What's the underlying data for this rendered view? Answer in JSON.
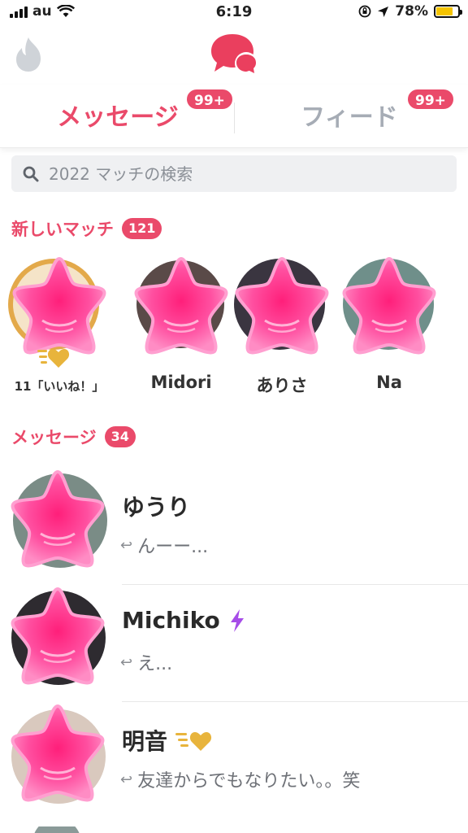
{
  "status_bar": {
    "carrier": "au",
    "time": "6:19",
    "battery_percent": "78%",
    "battery_level": 0.78
  },
  "tabs": [
    {
      "label": "メッセージ",
      "badge": "99+",
      "active": true
    },
    {
      "label": "フィード",
      "badge": "99+",
      "active": false
    }
  ],
  "search": {
    "placeholder": "2022 マッチの検索"
  },
  "new_matches": {
    "title": "新しいマッチ",
    "count": "121",
    "items": [
      {
        "name": "11「いいね！」",
        "avatar_icon": "star-sticker-icon",
        "likes_badge_icon": "super-like-icon"
      },
      {
        "name": "Midori",
        "avatar_icon": "star-sticker-icon"
      },
      {
        "name": "ありさ",
        "avatar_icon": "star-sticker-icon"
      },
      {
        "name": "Na",
        "avatar_icon": "star-sticker-icon"
      }
    ]
  },
  "messages": {
    "title": "メッセージ",
    "count": "34",
    "items": [
      {
        "name": "ゆうり",
        "preview": "んーー...",
        "name_icon": ""
      },
      {
        "name": "Michiko",
        "preview": "え...",
        "name_icon": "lightning-icon"
      },
      {
        "name": "明音",
        "preview": "友達からでもなりたい。。笑",
        "name_icon": "super-like-icon"
      }
    ]
  },
  "colors": {
    "accent": "#ea4a6a",
    "inactive_tab": "#a6acb5",
    "star_pink": "#ff3f94",
    "lightning": "#a64ce8",
    "gold": "#e8b43c"
  }
}
